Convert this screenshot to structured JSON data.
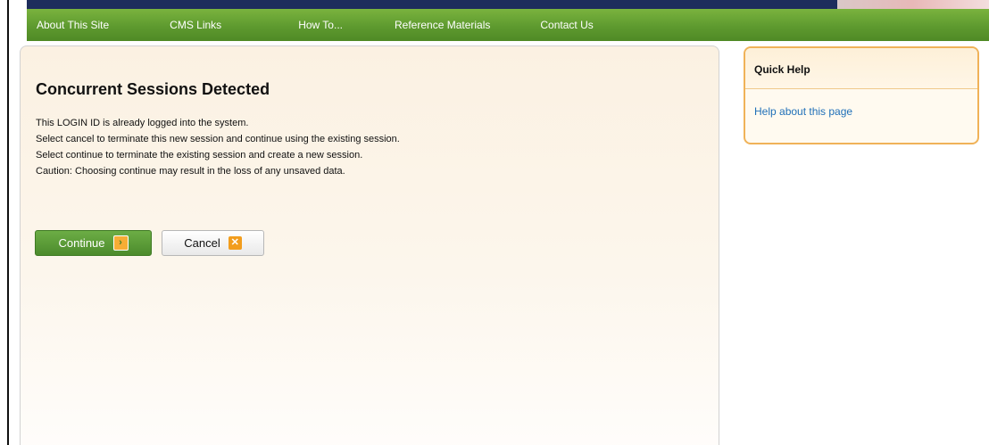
{
  "nav": {
    "items": [
      {
        "label": "About This Site",
        "name": "nav-item-about-this-site"
      },
      {
        "label": "CMS Links",
        "name": "nav-item-cms-links"
      },
      {
        "label": "How To...",
        "name": "nav-item-how-to"
      },
      {
        "label": "Reference Materials",
        "name": "nav-item-reference-materials"
      },
      {
        "label": "Contact Us",
        "name": "nav-item-contact-us"
      }
    ]
  },
  "main": {
    "title": "Concurrent Sessions Detected",
    "messages": [
      "This LOGIN ID is already logged into the system.",
      "Select cancel to terminate this new session and continue using the existing session.",
      "Select continue to terminate the existing session and create a new session.",
      "Caution: Choosing continue may result in the loss of any unsaved data."
    ],
    "buttons": {
      "continue_label": "Continue",
      "continue_icon": "arrow-right-icon",
      "cancel_label": "Cancel",
      "cancel_icon": "close-icon"
    }
  },
  "quick_help": {
    "title": "Quick Help",
    "link": "Help about this page"
  },
  "colors": {
    "nav_green": "#5e9a2f",
    "continue_green": "#4c8b2c",
    "accent_orange": "#f29d1d",
    "help_border": "#f0b258",
    "link_blue": "#1f6fb8",
    "panel_cream": "#fbf1e2"
  }
}
